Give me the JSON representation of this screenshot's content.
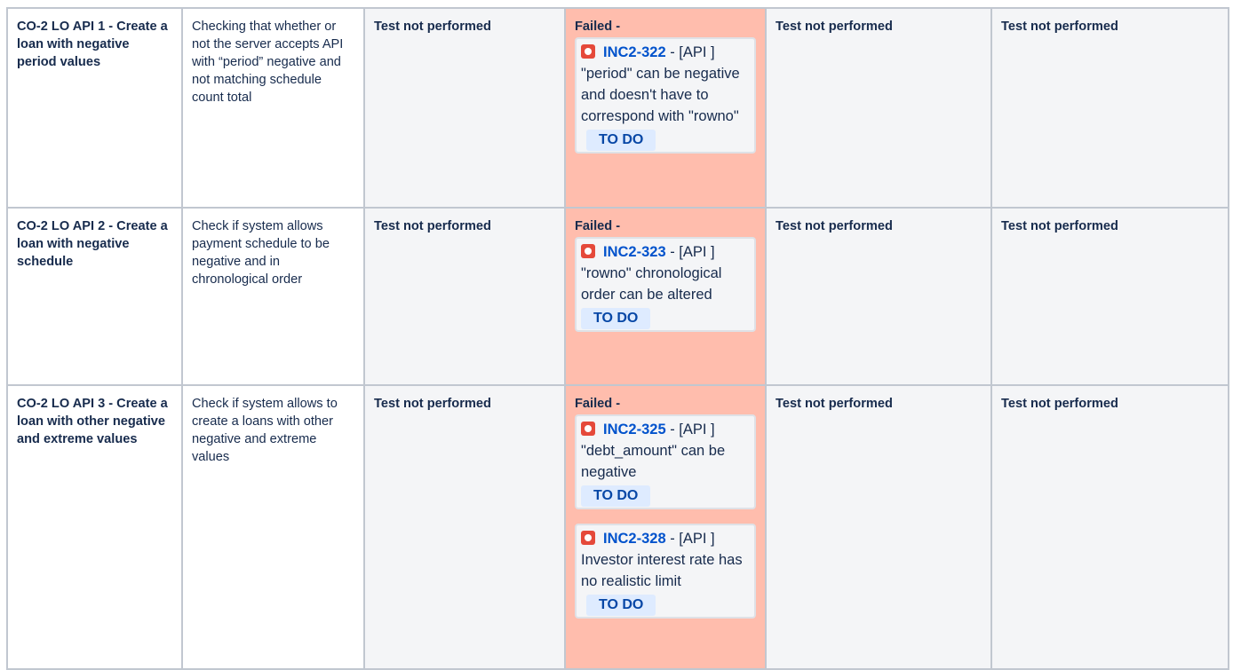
{
  "rows": [
    {
      "name": "CO-2 LO API 1 - Create a loan with negative period values",
      "description": "Checking that whether or not the server accepts API with “period” negative and not matching schedule count total",
      "env1": "Test not performed",
      "failed_label": "Failed -",
      "issues": [
        {
          "key": "INC2-322",
          "sep": " - ",
          "summary": "[API ] \"period\" can be negative and doesn't have to correspond with \"rowno\"",
          "status": "TO DO"
        }
      ],
      "env3": "Test not performed",
      "env4": "Test not performed"
    },
    {
      "name": "CO-2 LO API 2 - Create a loan with negative schedule",
      "description": "Check if system allows payment schedule to be negative and in chronological order",
      "env1": "Test not performed",
      "failed_label": "Failed -",
      "issues": [
        {
          "key": "INC2-323",
          "sep": " - ",
          "summary": "[API ] \"rowno\" chronological order can be altered",
          "status": "TO DO"
        }
      ],
      "env3": "Test not performed",
      "env4": "Test not performed"
    },
    {
      "name": "CO-2 LO API 3 - Create a loan with other negative and extreme values",
      "description": "Check if system allows to create a loans with other negative and extreme values",
      "env1": "Test not performed",
      "failed_label": "Failed -",
      "issues": [
        {
          "key": "INC2-325",
          "sep": " - ",
          "summary": "[API ] \"debt_amount\" can be negative",
          "status": "TO DO"
        },
        {
          "key": "INC2-328",
          "sep": " - ",
          "summary": "[API ] Investor interest rate has no realistic limit",
          "status": "TO DO"
        }
      ],
      "env3": "Test not performed",
      "env4": "Test not performed"
    }
  ],
  "colors": {
    "border": "#c1c7d0",
    "failed_bg": "#ffbdad",
    "neutral_bg": "#f4f5f7",
    "link": "#0052cc",
    "bug_icon": "#e5493a",
    "lozenge_bg": "#deebff"
  },
  "icons": {
    "issue_type": "bug-icon"
  }
}
